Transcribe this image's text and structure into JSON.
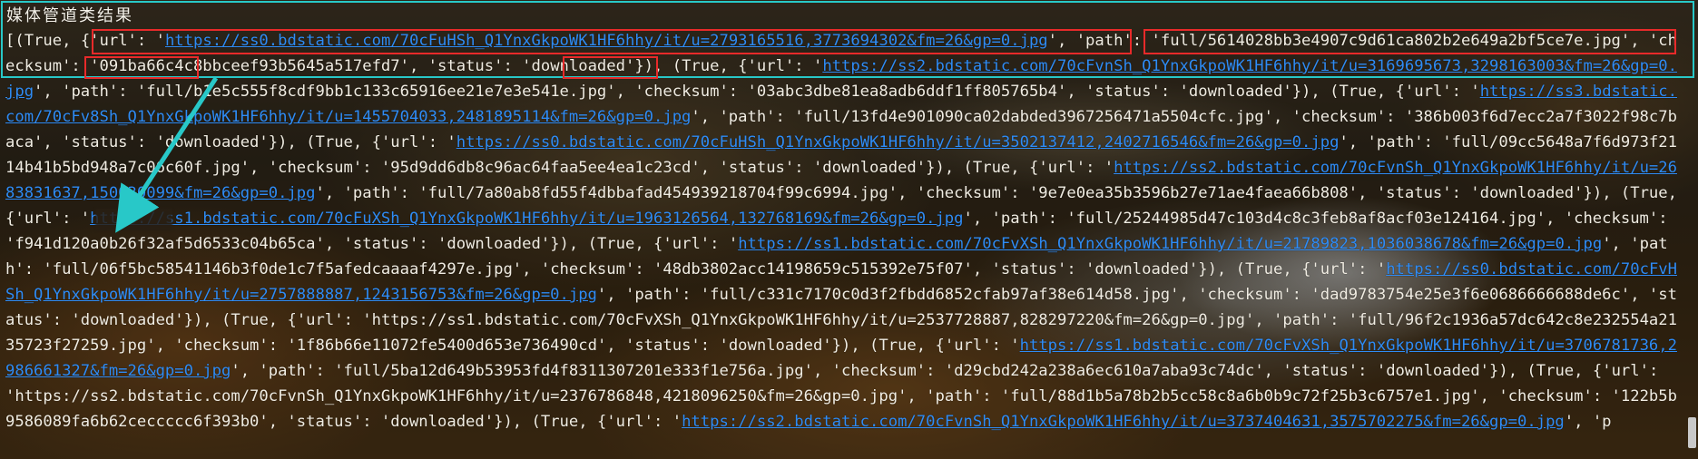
{
  "title": "媒体管道类结果",
  "results": [
    {
      "ok": "True",
      "url": "https://ss0.bdstatic.com/70cFuHSh_Q1YnxGkpoWK1HF6hhy/it/u=2793165516,3773694302&fm=26&gp=0.jpg",
      "path": "full/5614028bb3e4907c9d61ca802b2e649a2bf5ce7e.jpg",
      "checksum": "091ba66c4c8bbceef93b5645a517efd7",
      "status": "downloaded"
    },
    {
      "ok": "True",
      "url": "https://ss2.bdstatic.com/70cFvnSh_Q1YnxGkpoWK1HF6hhy/it/u=3169695673,3298163003&fm=26&gp=0.jpg",
      "path": "full/b1e5c555f8cdf9bb1c133c65916ee21e7e3e541e.jpg",
      "checksum": "03abc3dbe81ea8adb6ddf1ff805765b4",
      "status": "downloaded"
    },
    {
      "ok": "True",
      "url": "https://ss3.bdstatic.com/70cFv8Sh_Q1YnxGkpoWK1HF6hhy/it/u=1455704033,2481895114&fm=26&gp=0.jpg",
      "path": "full/13fd4e901090ca02dabded3967256471a5504cfc.jpg",
      "checksum": "386b003f6d7ecc2a7f3022f98c7baca",
      "status": "downloaded"
    },
    {
      "ok": "True",
      "url": "https://ss0.bdstatic.com/70cFuHSh_Q1YnxGkpoWK1HF6hhy/it/u=3502137412,2402716546&fm=26&gp=0.jpg",
      "path": "full/09cc5648a7f6d973f2114b41b5bd948a7c06c60f.jpg",
      "checksum": "95d9dd6db8c96ac64faa5ee4ea1c23cd",
      "status": "downloaded"
    },
    {
      "ok": "True",
      "url": "https://ss2.bdstatic.com/70cFvnSh_Q1YnxGkpoWK1HF6hhy/it/u=2683831637,150030099&fm=26&gp=0.jpg",
      "path": "full/7a80ab8fd55f4dbbafad454939218704f99c6994.jpg",
      "checksum": "9e7e0ea35b3596b27e71ae4faea66b808",
      "status": "downloaded"
    },
    {
      "ok": "True",
      "url": "https://ss1.bdstatic.com/70cFuXSh_Q1YnxGkpoWK1HF6hhy/it/u=1963126564,132768169&fm=26&gp=0.jpg",
      "path": "full/25244985d47c103d4c8c3feb8af8acf03e124164.jpg",
      "checksum": "f941d120a0b26f32af5d6533c04b65ca",
      "status": "downloaded"
    },
    {
      "ok": "True",
      "url": "https://ss1.bdstatic.com/70cFvXSh_Q1YnxGkpoWK1HF6hhy/it/u=21789823,1036038678&fm=26&gp=0.jpg",
      "path": "full/06f5bc58541146b3f0de1c7f5afedcaaaaf4297e.jpg",
      "checksum": "48db3802acc14198659c515392e75f07",
      "status": "downloaded"
    },
    {
      "ok": "True",
      "url": "https://ss0.bdstatic.com/70cFvHSh_Q1YnxGkpoWK1HF6hhy/it/u=2757888887,1243156753&fm=26&gp=0.jpg",
      "path": "full/c331c7170c0d3f2fbdd6852cfab97af38e614d58.jpg",
      "checksum": "dad9783754e25e3f6e0686666688de6c",
      "status": "downloaded"
    },
    {
      "ok": "True",
      "url": "https://ss1.bdstatic.com/70cFvXSh_Q1YnxGkpoWK1HF6hhy/it/u=2537728887,828297220&fm=26&gp=0.jpg",
      "path": "full/96f2c1936a57dc642c8e232554a2135723f27259.jpg",
      "checksum": "1f86b66e11072fe5400d653e736490cd",
      "status": "downloaded"
    },
    {
      "ok": "True",
      "url": "https://ss1.bdstatic.com/70cFvXSh_Q1YnxGkpoWK1HF6hhy/it/u=3706781736,2986661327&fm=26&gp=0.jpg",
      "path": "full/5ba12d649b53953fd4f8311307201e333f1e756a.jpg",
      "checksum": "d29cbd242a238a6ec610a7aba93c74dc",
      "status": "downloaded"
    },
    {
      "ok": "True",
      "url": "https://ss2.bdstatic.com/70cFvnSh_Q1YnxGkpoWK1HF6hhy/it/u=2376786848,4218096250&fm=26&gp=0.jpg",
      "path": "full/88d1b5a78b2b5cc58c8a6b0b9c72f25b3c6757e1.jpg",
      "checksum": "122b5b9586089fa6b62ceccccc6f393b0",
      "status": "downloaded"
    },
    {
      "ok": "True",
      "url": "https://ss2.bdstatic.com/70cFvnSh_Q1YnxGkpoWK1HF6hhy/it/u=3737404631,3575702275&fm=26&gp=0.jpg",
      "path": "",
      "checksum": "",
      "status": ""
    }
  ],
  "plain_url_indices": [
    8,
    10
  ],
  "colors": {
    "url": "#2f8cf5",
    "annotation_box": "#28c8c8",
    "highlight_box": "#e82a2a"
  }
}
